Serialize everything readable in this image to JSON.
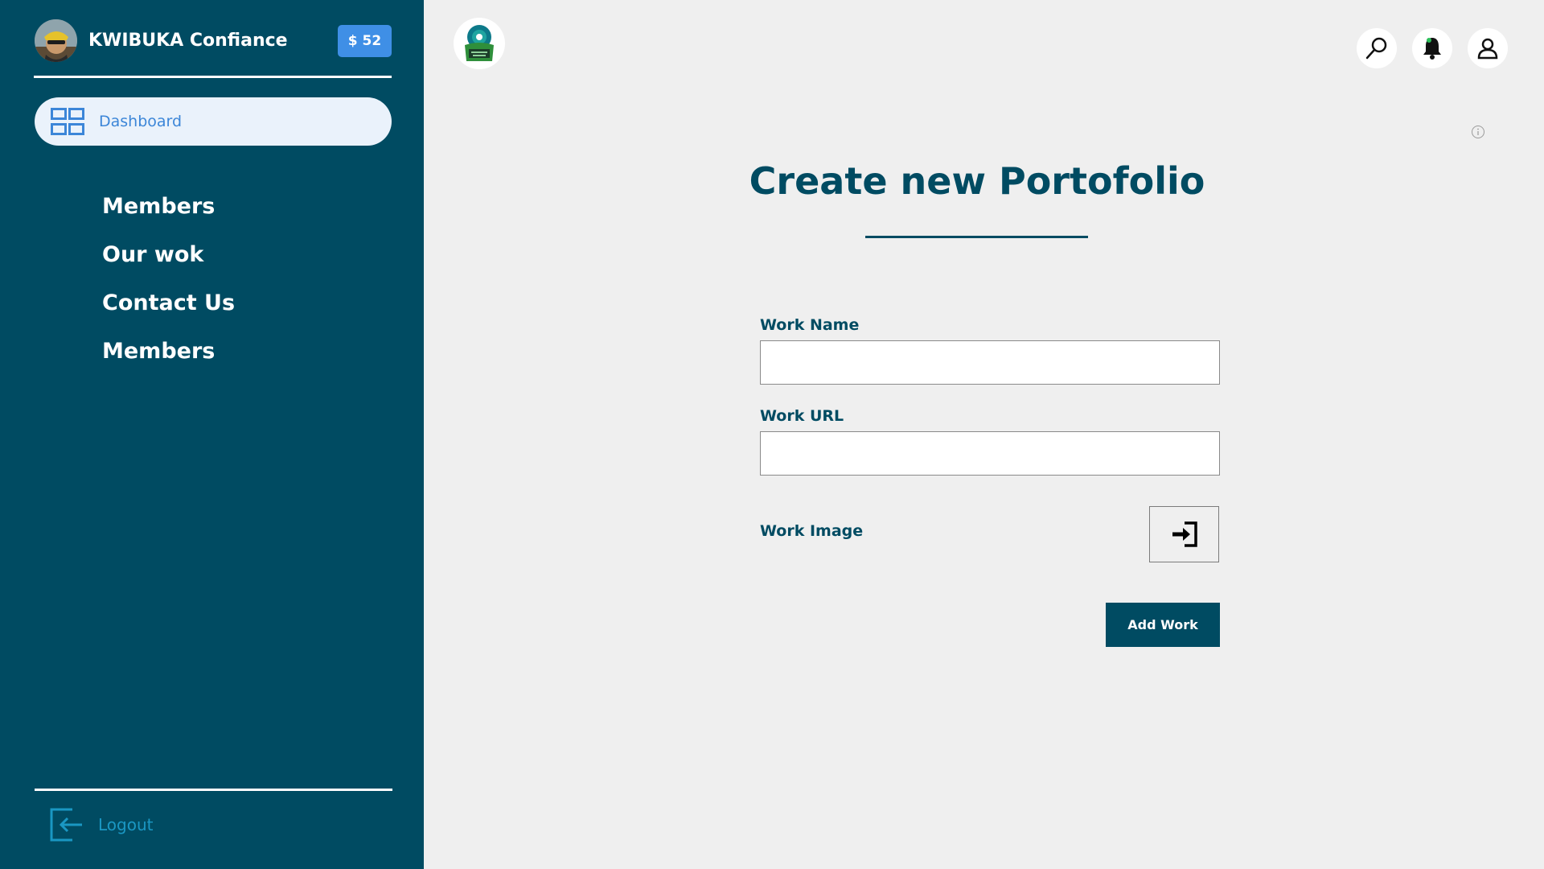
{
  "sidebar": {
    "profile_name": "KWIBUKA Confiance",
    "balance": "$ 52",
    "active_item": {
      "label": "Dashboard",
      "icon": "dashboard-grid-icon"
    },
    "items": [
      {
        "label": "Members"
      },
      {
        "label": "Our wok"
      },
      {
        "label": "Contact Us"
      },
      {
        "label": "Members"
      }
    ],
    "logout_label": "Logout"
  },
  "header": {
    "icons": [
      "search-icon",
      "bell-icon",
      "user-icon"
    ]
  },
  "form": {
    "title": "Create new Portofolio",
    "work_name_label": "Work Name",
    "work_name_value": "",
    "work_url_label": "Work URL",
    "work_url_value": "",
    "work_image_label": "Work Image",
    "submit_label": "Add Work"
  },
  "colors": {
    "sidebar_bg": "#004b62",
    "balance_bg": "#3f8fe6",
    "accent_text": "#004b62",
    "active_nav_bg": "#eaf2fb",
    "logout_color": "#1a97c3",
    "page_bg": "#efefef"
  }
}
